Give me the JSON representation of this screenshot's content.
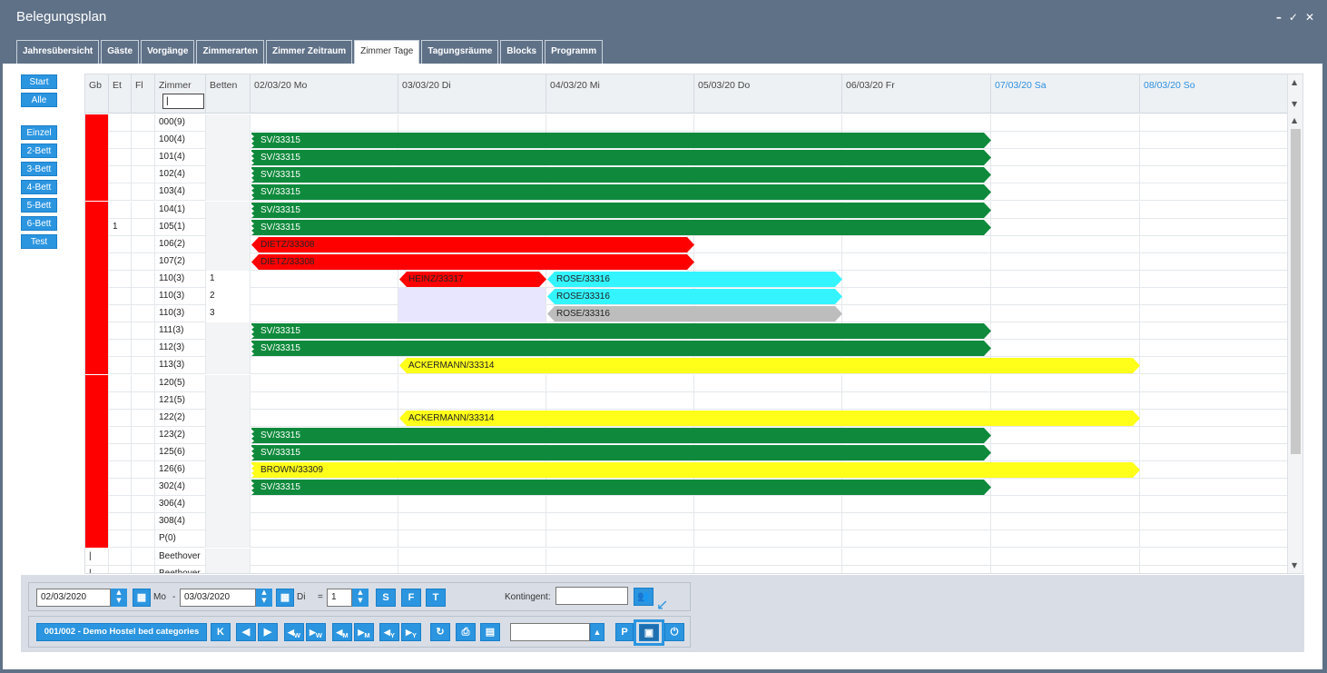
{
  "window": {
    "title": "Belegungsplan",
    "controls": [
      "–",
      "✓",
      "✕"
    ]
  },
  "tabs": [
    {
      "label": "Jahresübersicht",
      "active": false
    },
    {
      "label": "Gäste",
      "active": false
    },
    {
      "label": "Vorgänge",
      "active": false
    },
    {
      "label": "Zimmerarten",
      "active": false
    },
    {
      "label": "Zimmer Zeitraum",
      "active": false
    },
    {
      "label": "Zimmer Tage",
      "active": true
    },
    {
      "label": "Tagungsräume",
      "active": false
    },
    {
      "label": "Blocks",
      "active": false
    },
    {
      "label": "Programm",
      "active": false
    }
  ],
  "sidebar": {
    "top": [
      "Start",
      "Alle"
    ],
    "categories": [
      "Einzel",
      "2-Bett",
      "3-Bett",
      "4-Bett",
      "5-Bett",
      "6-Bett",
      "Test"
    ]
  },
  "grid": {
    "headers": {
      "gb": "Gb",
      "et": "Et",
      "fl": "Fl",
      "zimmer": "Zimmer",
      "betten": "Betten"
    },
    "zimmer_filter_value": "|",
    "days": [
      {
        "label": "02/03/20 Mo",
        "weekend": false
      },
      {
        "label": "03/03/20 Di",
        "weekend": false
      },
      {
        "label": "04/03/20 Mi",
        "weekend": false
      },
      {
        "label": "05/03/20 Do",
        "weekend": false
      },
      {
        "label": "06/03/20 Fr",
        "weekend": false
      },
      {
        "label": "07/03/20 Sa",
        "weekend": true
      },
      {
        "label": "08/03/20 So",
        "weekend": true
      }
    ],
    "rows": [
      {
        "gb": true,
        "et": "",
        "fl": "",
        "zimmer": "000(9)",
        "betten": "",
        "bookings": []
      },
      {
        "gb": true,
        "et": "",
        "fl": "",
        "zimmer": "100(4)",
        "betten": "",
        "bookings": [
          {
            "label": "SV/33315",
            "color": "green",
            "start": 0,
            "end": 5,
            "shape": "zig"
          }
        ]
      },
      {
        "gb": true,
        "et": "",
        "fl": "",
        "zimmer": "101(4)",
        "betten": "",
        "bookings": [
          {
            "label": "SV/33315",
            "color": "green",
            "start": 0,
            "end": 5,
            "shape": "zig"
          }
        ]
      },
      {
        "gb": true,
        "et": "",
        "fl": "",
        "zimmer": "102(4)",
        "betten": "",
        "bookings": [
          {
            "label": "SV/33315",
            "color": "green",
            "start": 0,
            "end": 5,
            "shape": "zig"
          }
        ]
      },
      {
        "gb": true,
        "et": "",
        "fl": "",
        "zimmer": "103(4)",
        "betten": "",
        "bookings": [
          {
            "label": "SV/33315",
            "color": "green",
            "start": 0,
            "end": 5,
            "shape": "zig"
          }
        ]
      },
      {
        "gb": true,
        "et": "",
        "fl": "",
        "zimmer": "104(1)",
        "betten": "",
        "bookings": [
          {
            "label": "SV/33315",
            "color": "green",
            "start": 0,
            "end": 5,
            "shape": "zig"
          }
        ]
      },
      {
        "gb": true,
        "et": "1",
        "fl": "",
        "zimmer": "105(1)",
        "betten": "",
        "bookings": [
          {
            "label": "SV/33315",
            "color": "green",
            "start": 0,
            "end": 5,
            "shape": "zig"
          }
        ]
      },
      {
        "gb": true,
        "et": "",
        "fl": "",
        "zimmer": "106(2)",
        "betten": "",
        "bookings": [
          {
            "label": "DIETZ/33308",
            "color": "red",
            "start": 0,
            "end": 3,
            "shape": "lr"
          }
        ]
      },
      {
        "gb": true,
        "et": "",
        "fl": "",
        "zimmer": "107(2)",
        "betten": "",
        "bookings": [
          {
            "label": "DIETZ/33308",
            "color": "red",
            "start": 0,
            "end": 3,
            "shape": "lr"
          }
        ]
      },
      {
        "gb": true,
        "et": "",
        "fl": "",
        "zimmer": "110(3)",
        "betten": "1",
        "bookings": [
          {
            "label": "HEINZ/33317",
            "color": "red",
            "start": 1,
            "end": 2,
            "shape": "lr"
          },
          {
            "label": "ROSE/33316",
            "color": "cyan",
            "start": 2,
            "end": 4,
            "shape": "lr"
          }
        ]
      },
      {
        "gb": true,
        "et": "",
        "fl": "",
        "zimmer": "110(3)",
        "betten": "2",
        "lavender": true,
        "bookings": [
          {
            "label": "ROSE/33316",
            "color": "cyan",
            "start": 2,
            "end": 4,
            "shape": "lr"
          }
        ]
      },
      {
        "gb": true,
        "et": "",
        "fl": "",
        "zimmer": "110(3)",
        "betten": "3",
        "lavender": true,
        "bookings": [
          {
            "label": "ROSE/33316",
            "color": "grey",
            "start": 2,
            "end": 4,
            "shape": "lr"
          }
        ]
      },
      {
        "gb": true,
        "et": "",
        "fl": "",
        "zimmer": "111(3)",
        "betten": "",
        "bookings": [
          {
            "label": "SV/33315",
            "color": "green",
            "start": 0,
            "end": 5,
            "shape": "zig"
          }
        ]
      },
      {
        "gb": true,
        "et": "",
        "fl": "",
        "zimmer": "112(3)",
        "betten": "",
        "bookings": [
          {
            "label": "SV/33315",
            "color": "green",
            "start": 0,
            "end": 5,
            "shape": "zig"
          }
        ]
      },
      {
        "gb": true,
        "et": "",
        "fl": "",
        "zimmer": "113(3)",
        "betten": "",
        "bookings": [
          {
            "label": "ACKERMANN/33314",
            "color": "yellow",
            "start": 1,
            "end": 6,
            "shape": "lr"
          }
        ]
      },
      {
        "gb": true,
        "et": "",
        "fl": "",
        "zimmer": "120(5)",
        "betten": "",
        "bookings": []
      },
      {
        "gb": true,
        "et": "",
        "fl": "",
        "zimmer": "121(5)",
        "betten": "",
        "bookings": []
      },
      {
        "gb": true,
        "et": "",
        "fl": "",
        "zimmer": "122(2)",
        "betten": "",
        "bookings": [
          {
            "label": "ACKERMANN/33314",
            "color": "yellow",
            "start": 1,
            "end": 6,
            "shape": "lr"
          }
        ]
      },
      {
        "gb": true,
        "et": "",
        "fl": "",
        "zimmer": "123(2)",
        "betten": "",
        "bookings": [
          {
            "label": "SV/33315",
            "color": "green",
            "start": 0,
            "end": 5,
            "shape": "zig"
          }
        ]
      },
      {
        "gb": true,
        "et": "",
        "fl": "",
        "zimmer": "125(6)",
        "betten": "",
        "bookings": [
          {
            "label": "SV/33315",
            "color": "green",
            "start": 0,
            "end": 5,
            "shape": "zig"
          }
        ]
      },
      {
        "gb": true,
        "et": "",
        "fl": "",
        "zimmer": "126(6)",
        "betten": "",
        "bookings": [
          {
            "label": "BROWN/33309",
            "color": "yellow",
            "start": 0,
            "end": 6,
            "shape": "zig"
          }
        ]
      },
      {
        "gb": true,
        "et": "",
        "fl": "",
        "zimmer": "302(4)",
        "betten": "",
        "bookings": [
          {
            "label": "SV/33315",
            "color": "green",
            "start": 0,
            "end": 5,
            "shape": "zig"
          }
        ]
      },
      {
        "gb": true,
        "et": "",
        "fl": "",
        "zimmer": "306(4)",
        "betten": "",
        "bookings": []
      },
      {
        "gb": true,
        "et": "",
        "fl": "",
        "zimmer": "308(4)",
        "betten": "",
        "bookings": []
      },
      {
        "gb": true,
        "et": "",
        "fl": "",
        "zimmer": "P(0)",
        "betten": "",
        "bookings": []
      },
      {
        "gb": false,
        "gb_text": "|",
        "et": "",
        "fl": "",
        "zimmer": "Beethover",
        "betten": "",
        "bookings": []
      },
      {
        "gb": false,
        "gb_text": "|",
        "et": "",
        "fl": "",
        "zimmer": "Beethover",
        "betten": "",
        "bookings": []
      }
    ]
  },
  "footer": {
    "date_from": "02/03/2020",
    "day_from": "Mo",
    "dash": "-",
    "date_to": "03/03/2020",
    "day_to": "Di",
    "equals": "=",
    "nights": "1",
    "btn_s": "S",
    "btn_f": "F",
    "btn_t": "T",
    "kontingent_label": "Kontingent:",
    "kontingent_value": "",
    "hotel_button": "001/002 - Demo Hostel bed categories",
    "btn_k": "K",
    "btn_p": "P",
    "nav_subs": [
      "W",
      "W",
      "M",
      "M",
      "Y",
      "Y"
    ],
    "dropdown_value": ""
  },
  "colors": {
    "green": "#0f8a3c",
    "red": "#ff0000",
    "cyan": "#33f4ff",
    "yellow": "#ffff1a",
    "grey": "#bdbdbd",
    "accent": "#2b95e0"
  }
}
